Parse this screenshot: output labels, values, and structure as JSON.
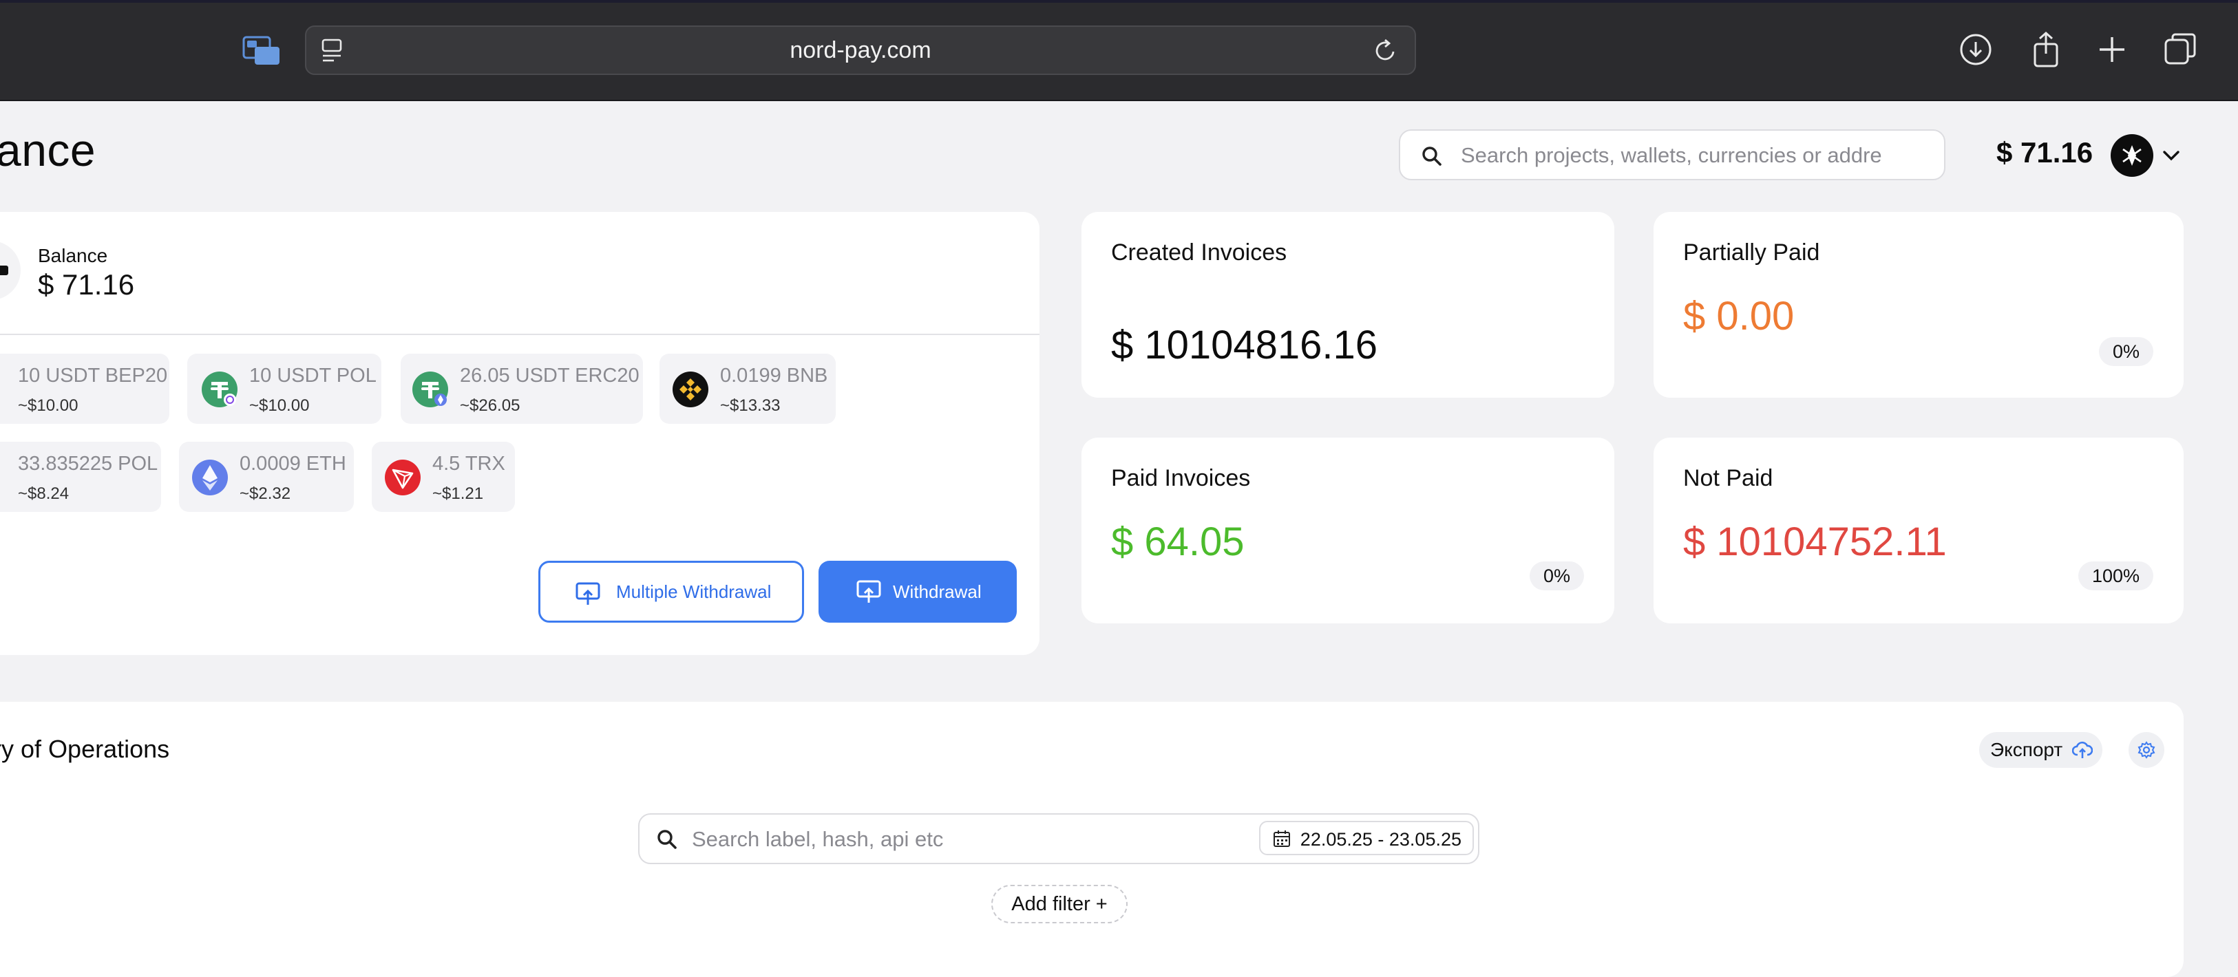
{
  "browser": {
    "url": "nord-pay.com"
  },
  "header": {
    "page_title": "ance",
    "search_placeholder": "Search projects, wallets, currencies or addre",
    "balance": "$ 71.16"
  },
  "balance_card": {
    "label": "Balance",
    "value": "$ 71.16",
    "coins": [
      {
        "amount": "10 USDT BEP20",
        "usd": "~$10.00",
        "icon": "tether-bep20-icon"
      },
      {
        "amount": "10 USDT POL",
        "usd": "~$10.00",
        "icon": "tether-pol-icon"
      },
      {
        "amount": "26.05 USDT ERC20",
        "usd": "~$26.05",
        "icon": "tether-erc20-icon"
      },
      {
        "amount": "0.0199 BNB",
        "usd": "~$13.33",
        "icon": "bnb-icon"
      },
      {
        "amount": "33.835225 POL",
        "usd": "~$8.24",
        "icon": "polygon-icon"
      },
      {
        "amount": "0.0009 ETH",
        "usd": "~$2.32",
        "icon": "ethereum-icon"
      },
      {
        "amount": "4.5 TRX",
        "usd": "~$1.21",
        "icon": "tron-icon"
      }
    ],
    "multiple_withdrawal_label": "Multiple Withdrawal",
    "withdrawal_label": "Withdrawal"
  },
  "stats": {
    "created": {
      "title": "Created Invoices",
      "value": "$ 10104816.16"
    },
    "partially_paid": {
      "title": "Partially Paid",
      "value": "$ 0.00",
      "percent": "0%",
      "color": "#ee7b33"
    },
    "paid": {
      "title": "Paid Invoices",
      "value": "$ 64.05",
      "percent": "0%",
      "color": "#4cbb2c"
    },
    "not_paid": {
      "title": "Not Paid",
      "value": "$ 10104752.11",
      "percent": "100%",
      "color": "#e04841"
    }
  },
  "history": {
    "title": "tory of Operations",
    "export_label": "Экспорт",
    "search_placeholder": "Search label, hash, api etc",
    "date_range": "22.05.25 - 23.05.25",
    "add_filter_label": "Add filter +"
  },
  "colors": {
    "accent": "#3d7bf0",
    "chrome": "#2b2b2e"
  }
}
